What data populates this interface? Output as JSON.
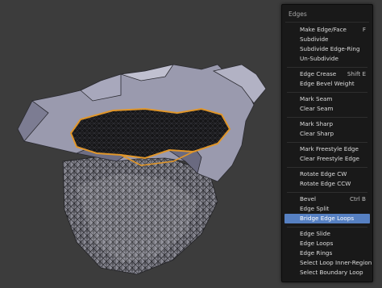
{
  "menu": {
    "title": "Edges",
    "groups": [
      [
        {
          "label": "Make Edge/Face",
          "shortcut": "F"
        },
        {
          "label": "Subdivide",
          "shortcut": ""
        },
        {
          "label": "Subdivide Edge-Ring",
          "shortcut": ""
        },
        {
          "label": "Un-Subdivide",
          "shortcut": ""
        }
      ],
      [
        {
          "label": "Edge Crease",
          "shortcut": "Shift E"
        },
        {
          "label": "Edge Bevel Weight",
          "shortcut": ""
        }
      ],
      [
        {
          "label": "Mark Seam",
          "shortcut": ""
        },
        {
          "label": "Clear Seam",
          "shortcut": ""
        }
      ],
      [
        {
          "label": "Mark Sharp",
          "shortcut": ""
        },
        {
          "label": "Clear Sharp",
          "shortcut": ""
        }
      ],
      [
        {
          "label": "Mark Freestyle Edge",
          "shortcut": ""
        },
        {
          "label": "Clear Freestyle Edge",
          "shortcut": ""
        }
      ],
      [
        {
          "label": "Rotate Edge CW",
          "shortcut": ""
        },
        {
          "label": "Rotate Edge CCW",
          "shortcut": ""
        }
      ],
      [
        {
          "label": "Bevel",
          "shortcut": "Ctrl B"
        },
        {
          "label": "Edge Split",
          "shortcut": ""
        },
        {
          "label": "Bridge Edge Loops",
          "shortcut": "",
          "highlighted": true
        }
      ],
      [
        {
          "label": "Edge Slide",
          "shortcut": ""
        },
        {
          "label": "Edge Loops",
          "shortcut": ""
        },
        {
          "label": "Edge Rings",
          "shortcut": ""
        },
        {
          "label": "Select Loop Inner-Region",
          "shortcut": ""
        },
        {
          "label": "Select Boundary Loop",
          "shortcut": ""
        }
      ]
    ]
  },
  "colors": {
    "viewport_bg": "#3c3c3c",
    "menu_bg": "#191919",
    "highlight": "#5680c2",
    "mesh_face": "#9a9aae",
    "selected_edge": "#e0962a"
  }
}
